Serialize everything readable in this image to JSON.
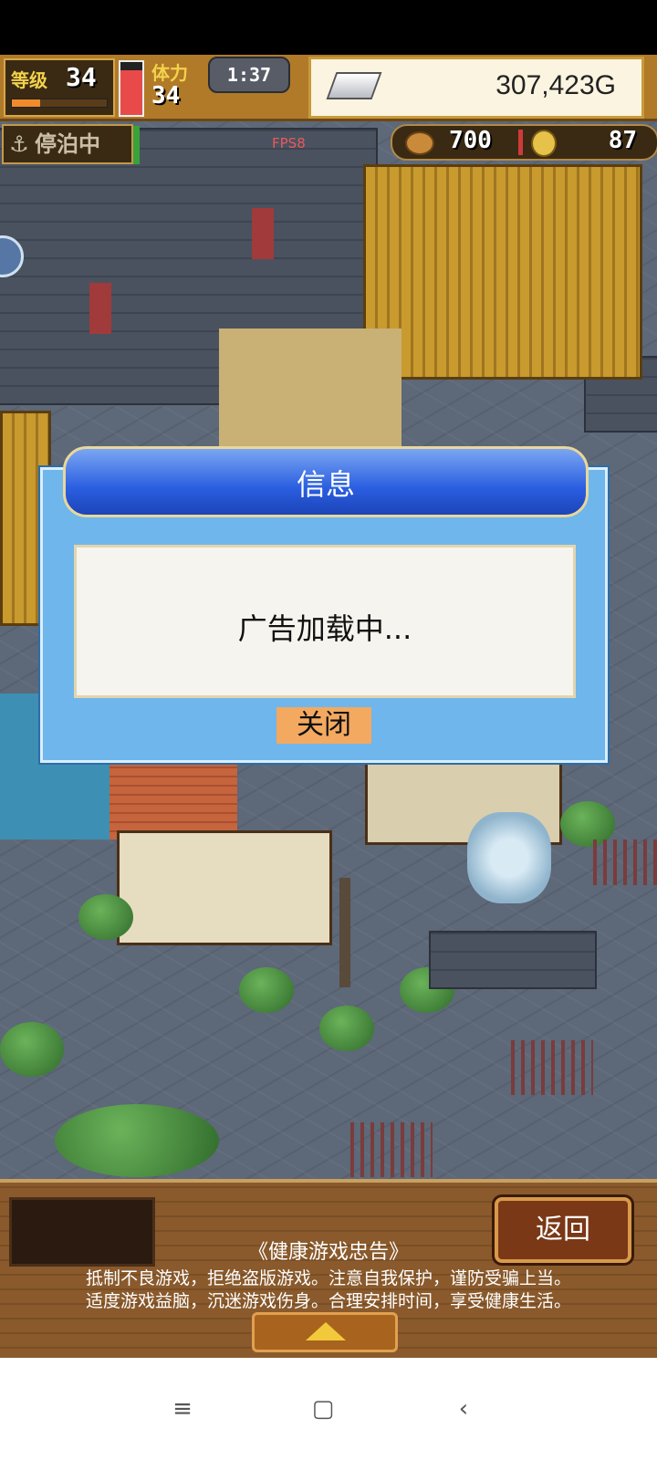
{
  "hud": {
    "level_label": "等级",
    "level_value": "34",
    "level_progress": 0.3,
    "stamina_label": "体力",
    "stamina_value": "34",
    "stamina_level": 0.85,
    "timer": "1:37",
    "gold": "307,423G",
    "dock_status": "停泊中",
    "fps": "FPS8",
    "resource_food": "700",
    "resource_medals": "87"
  },
  "dialog": {
    "title": "信息",
    "message": "广告加载中...",
    "close_label": "关闭"
  },
  "bottom": {
    "back_label": "返回",
    "advice_title": "《健康游戏忠告》",
    "advice_line1": "抵制不良游戏，拒绝盗版游戏。注意自我保护，谨防受骗上当。",
    "advice_line2": "适度游戏益脑，沉迷游戏伤身。合理安排时间，享受健康生活。"
  },
  "navbar": {
    "menu_icon": "≡",
    "home_icon": "▢",
    "back_icon": "‹"
  },
  "colors": {
    "dialog_blue": "#6fb6ec",
    "close_button": "#f3a95f",
    "hud_gold": "#b07a28"
  }
}
